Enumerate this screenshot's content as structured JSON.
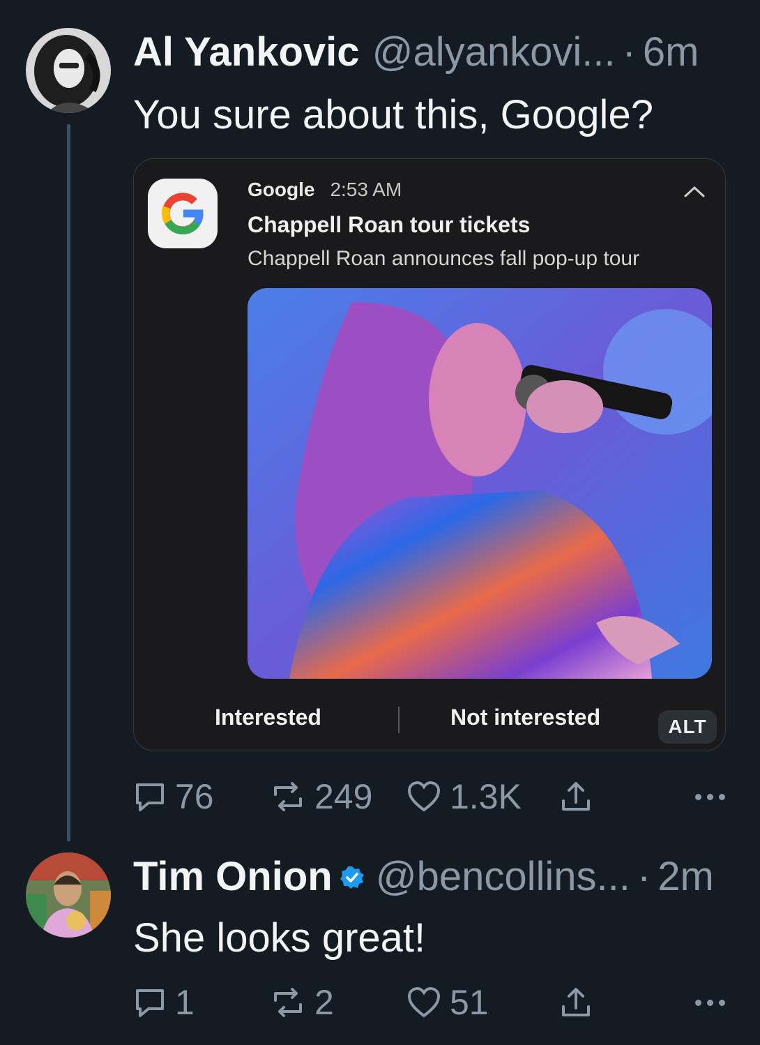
{
  "tweet1": {
    "name": "Al Yankovic",
    "handle": "@alyankovi...",
    "separator": "·",
    "time": "6m",
    "text": "You sure about this, Google?",
    "card": {
      "app_name": "Google",
      "notif_time": "2:53 AM",
      "title": "Chappell Roan tour tickets",
      "body": "Chappell Roan announces fall pop-up tour",
      "action_interested": "Interested",
      "action_not_interested": "Not interested",
      "alt_label": "ALT"
    },
    "stats": {
      "replies": "76",
      "reposts": "249",
      "likes": "1.3K"
    }
  },
  "tweet2": {
    "name": "Tim Onion",
    "handle": "@bencollins...",
    "separator": "·",
    "time": "2m",
    "text": "She looks great!",
    "stats": {
      "replies": "1",
      "reposts": "2",
      "likes": "51"
    }
  },
  "icons": {
    "reply": "reply-icon",
    "repost": "repost-icon",
    "like": "heart-icon",
    "share": "share-icon",
    "more": "more-icon",
    "verified": "verified-badge-icon"
  },
  "colors": {
    "background": "#151b23",
    "verified": "#1d9bf0",
    "muted": "#8b98a5"
  }
}
